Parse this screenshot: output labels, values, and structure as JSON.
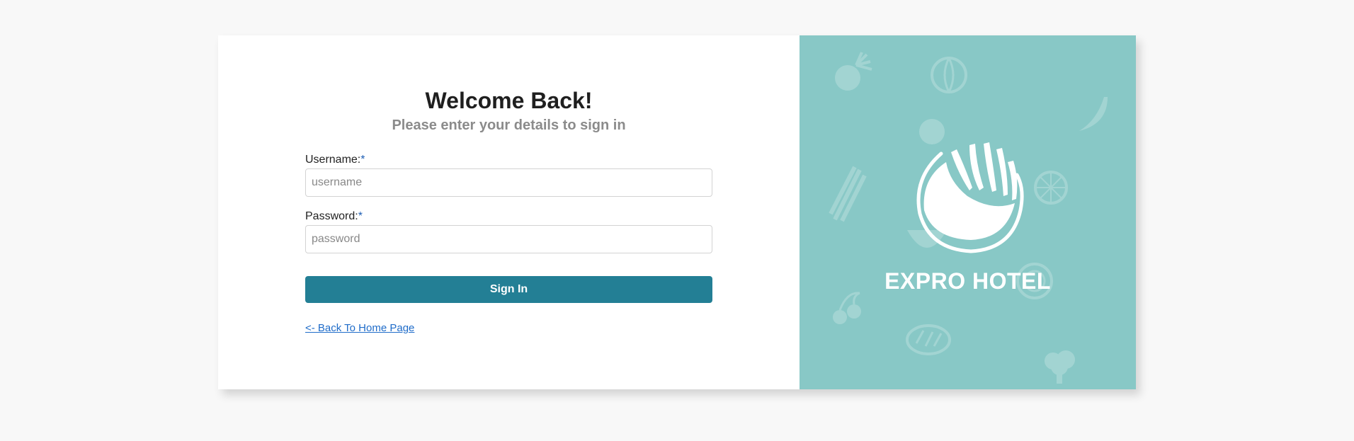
{
  "login": {
    "title": "Welcome Back!",
    "subtitle": "Please enter your details to sign in",
    "username_label": "Username:",
    "username_required": "*",
    "username_placeholder": "username",
    "password_label": "Password:",
    "password_required": "*",
    "password_placeholder": "password",
    "signin_label": "Sign In",
    "back_link": "<- Back To Home Page"
  },
  "brand": {
    "name": "EXPRO HOTEL",
    "logo_icon": "leaf-swirl-logo-icon",
    "background_color": "#88c8c6"
  },
  "colors": {
    "primary_button": "#237f95",
    "link": "#1f6cc9",
    "required_marker": "#1f5fb5"
  }
}
